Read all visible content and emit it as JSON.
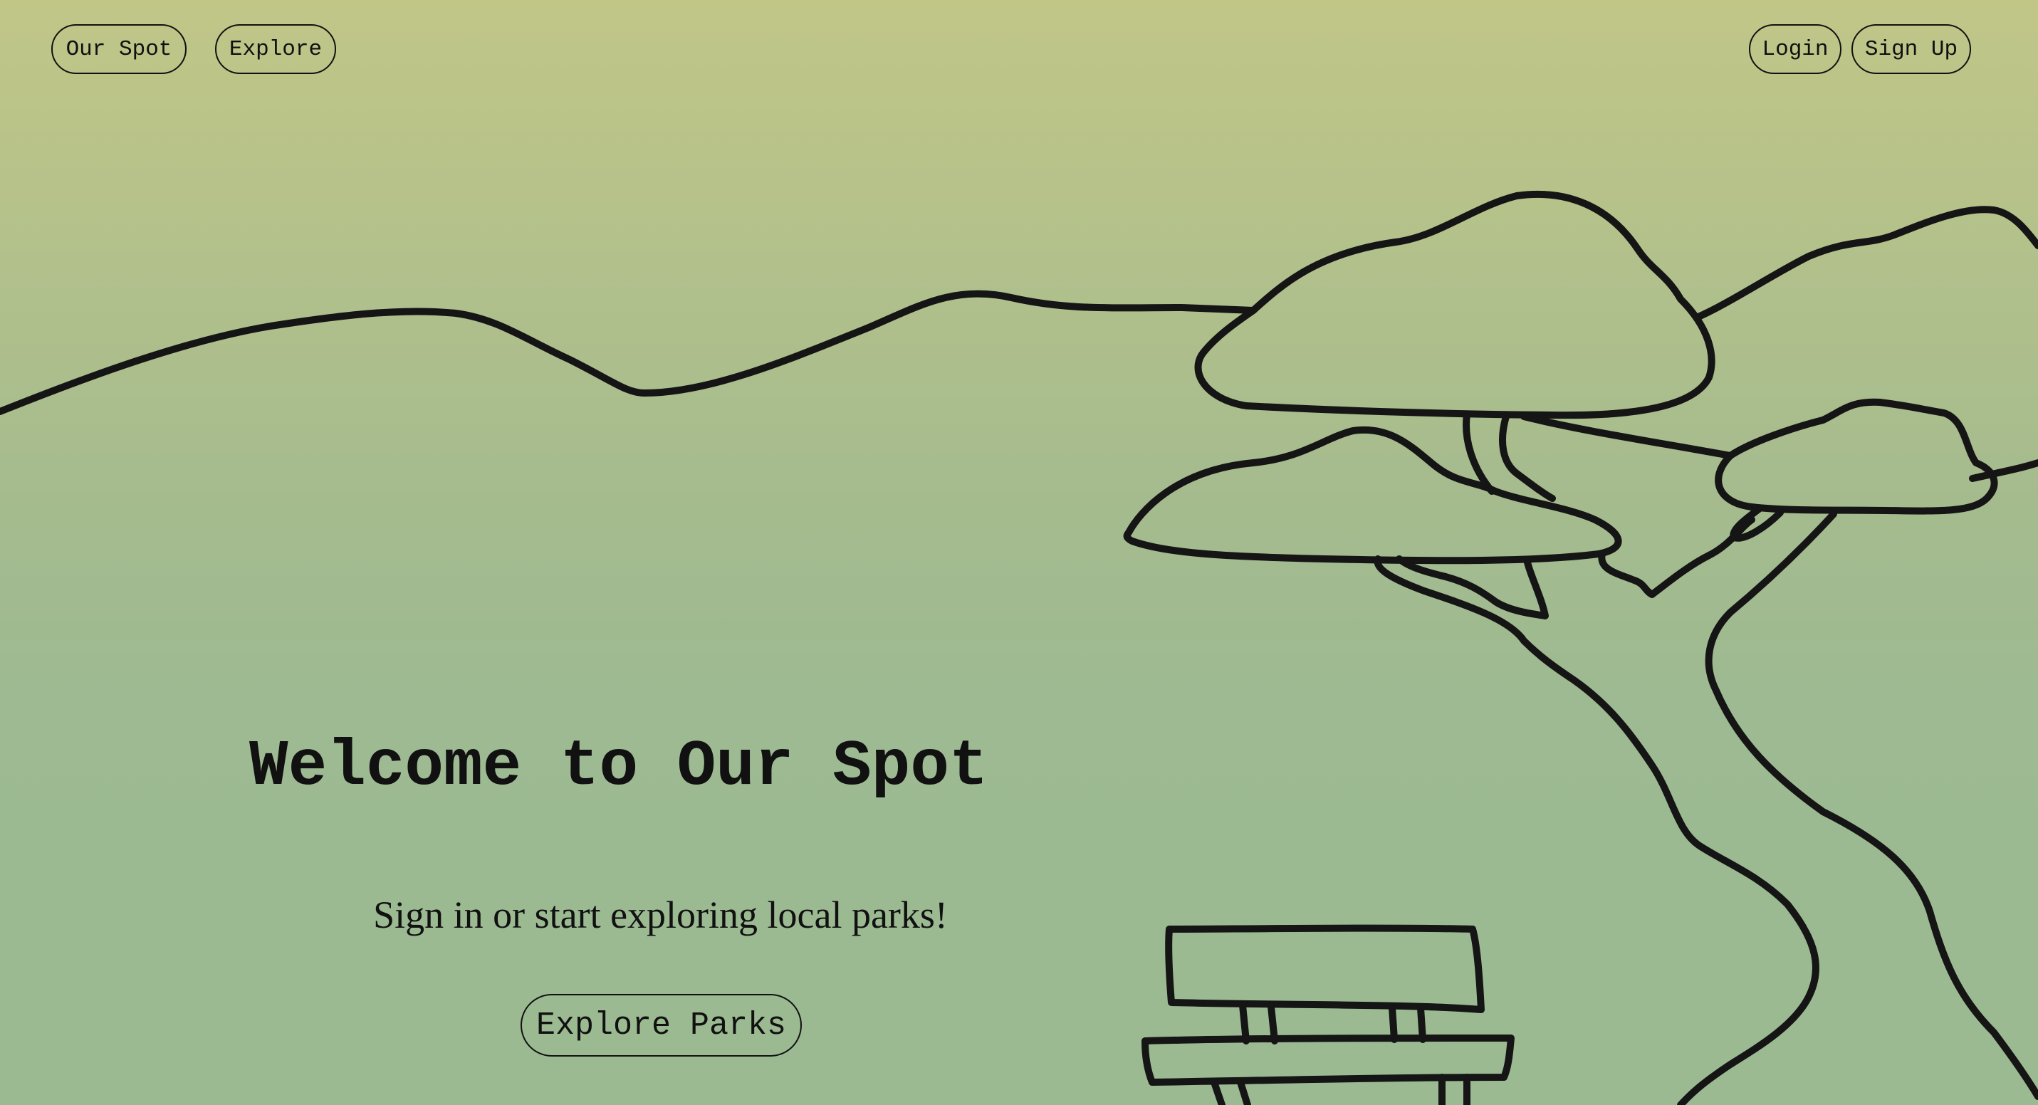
{
  "nav": {
    "brand_label": "Our Spot",
    "explore_label": "Explore",
    "login_label": "Login",
    "signup_label": "Sign Up"
  },
  "hero": {
    "title": "Welcome to Our Spot",
    "subtitle": "Sign in or start exploring local parks!",
    "cta_label": "Explore Parks"
  },
  "colors": {
    "bg_top": "#c1c687",
    "bg_bottom": "#9bba92",
    "ink": "#111111"
  }
}
